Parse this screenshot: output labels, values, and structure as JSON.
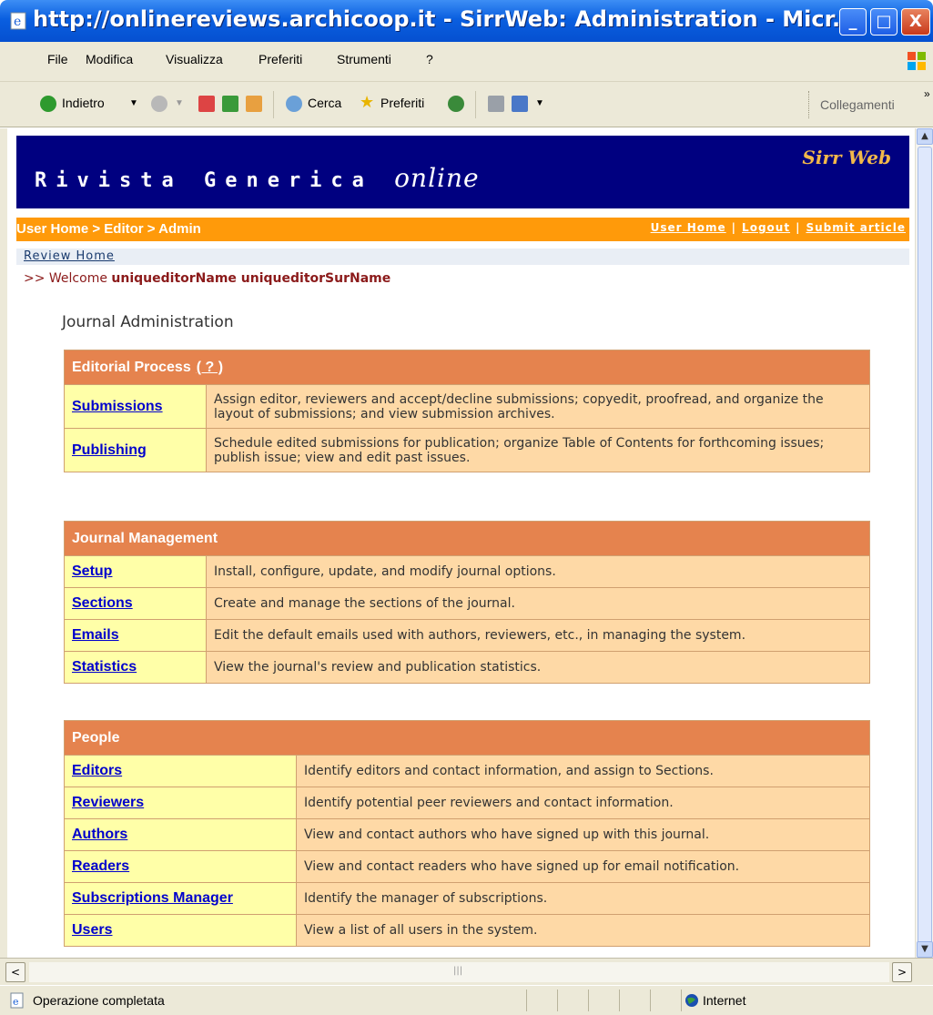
{
  "window": {
    "title": "http://onlinereviews.archicoop.it - SirrWeb: Administration - Micr...",
    "min_glyph": "_",
    "max_glyph": "□",
    "close_glyph": "X"
  },
  "menu": [
    "File",
    "Modifica",
    "Visualizza",
    "Preferiti",
    "Strumenti",
    "?"
  ],
  "toolbar": {
    "back": "Indietro",
    "search": "Cerca",
    "favorites": "Preferiti",
    "links": "Collegamenti",
    "chevron": "»"
  },
  "site": {
    "title_main": "Rivista Generica",
    "title_italic": "online",
    "brand": "Sirr Web",
    "breadcrumb": "User Home > Editor > Admin",
    "nav": [
      "User Home",
      "Logout",
      "Submit article"
    ],
    "nav_sep": "|",
    "review_home": "Review Home",
    "welcome_prefix": ">> Welcome",
    "welcome_name": "uniqueditorName uniqueditorSurName",
    "heading": "Journal Administration"
  },
  "sections": [
    {
      "title": "Editorial Process",
      "help": "( ? )",
      "rows": [
        {
          "label": "Submissions",
          "desc": "Assign editor, reviewers and accept/decline submissions; copyedit, proofread, and organize the layout of submissions; and view submission archives."
        },
        {
          "label": "Publishing",
          "desc": "Schedule edited submissions for publication; organize Table of Contents for forthcoming issues; publish issue; view and edit past issues."
        }
      ]
    },
    {
      "title": "Journal Management",
      "rows": [
        {
          "label": "Setup",
          "desc": "Install, configure, update, and modify journal options."
        },
        {
          "label": "Sections",
          "desc": "Create and manage the sections of the journal."
        },
        {
          "label": "Emails",
          "desc": "Edit the default emails used with authors, reviewers, etc., in managing the system."
        },
        {
          "label": "Statistics",
          "desc": "View the journal's review and publication statistics."
        }
      ]
    },
    {
      "title": "People",
      "rows": [
        {
          "label": "Editors",
          "desc": "Identify editors and contact information, and assign to Sections."
        },
        {
          "label": "Reviewers",
          "desc": "Identify potential peer reviewers and contact information."
        },
        {
          "label": "Authors",
          "desc": "View and contact authors who have signed up with this journal."
        },
        {
          "label": "Readers",
          "desc": "View and contact readers who have signed up for email notification."
        },
        {
          "label": "Subscriptions Manager",
          "desc": "Identify the manager of subscriptions."
        },
        {
          "label": "Users",
          "desc": "View a list of all users in the system."
        }
      ]
    }
  ],
  "scroll": {
    "up": "▲",
    "down": "▼",
    "left": "<",
    "right": ">",
    "grip": "|||"
  },
  "status": {
    "text": "Operazione completata",
    "zone": "Internet"
  }
}
